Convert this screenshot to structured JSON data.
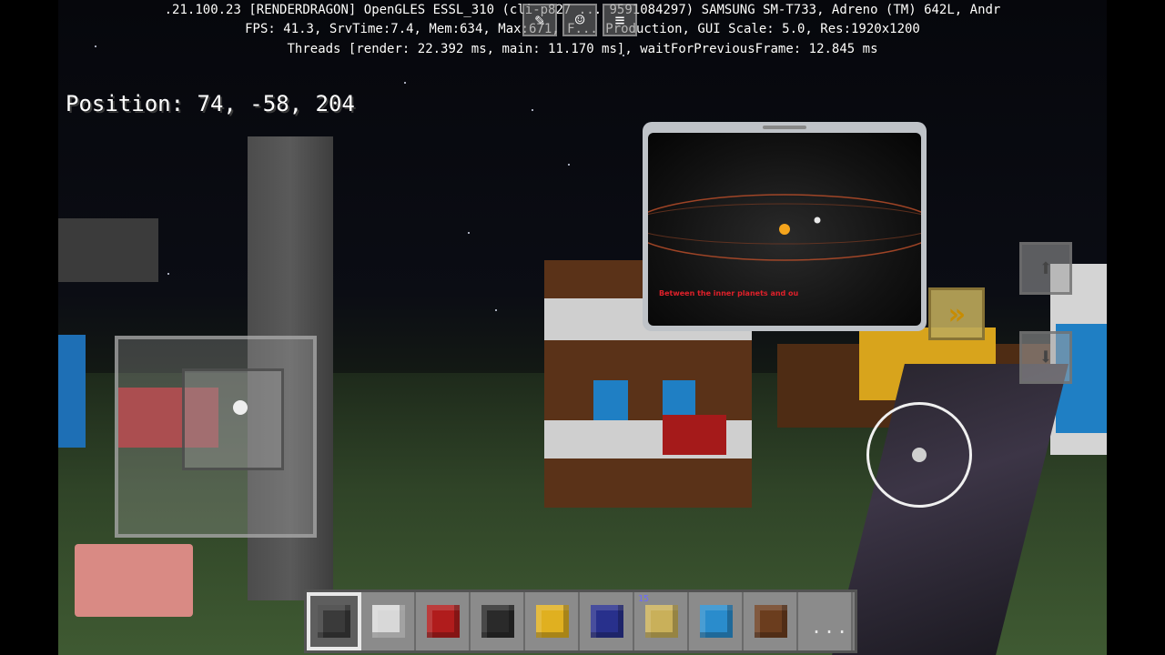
{
  "debug": {
    "line1": ".21.100.23 [RENDERDRAGON] OpenGLES ESSL_310 (cli-p827 ... 9591084297) SAMSUNG SM-T733, Adreno (TM) 642L, Andr",
    "line2": "FPS: 41.3, SrvTime:7.4, Mem:634, Max:671, F... Production, GUI Scale: 5.0, Res:1920x1200",
    "line3": "Threads [render: 22.392 ms, main: 11.170 ms], waitForPreviousFrame: 12.845 ms"
  },
  "position": "Position: 74, -58, 204",
  "video": {
    "caption": "Between the inner planets and ou"
  },
  "controls": {
    "skip_icon": "»",
    "fly_up_icon": "⬆",
    "fly_down_icon": "⬇",
    "more_label": "...",
    "icons": [
      "chat-icon",
      "emote-icon",
      "pause-menu-icon"
    ]
  },
  "hotbar": {
    "slots": [
      {
        "item": "grappling-hook",
        "color": "#3a3a3a"
      },
      {
        "item": "white-wool",
        "color": "#d8d8d8"
      },
      {
        "item": "red-wool",
        "color": "#b01c1c"
      },
      {
        "item": "black-wool",
        "color": "#2a2a2a"
      },
      {
        "item": "yellow-wool",
        "color": "#e0b020"
      },
      {
        "item": "blue-wool",
        "color": "#28308c"
      },
      {
        "item": "glowstone",
        "color": "#c9b05a",
        "count": "15"
      },
      {
        "item": "light-blue-wool",
        "color": "#2a8ccc"
      },
      {
        "item": "brown-wool",
        "color": "#6b3d1e"
      },
      {
        "item": "more",
        "label": "..."
      }
    ]
  },
  "colors": {
    "sky": "#0b0d14",
    "grass": "#3f5a32"
  }
}
